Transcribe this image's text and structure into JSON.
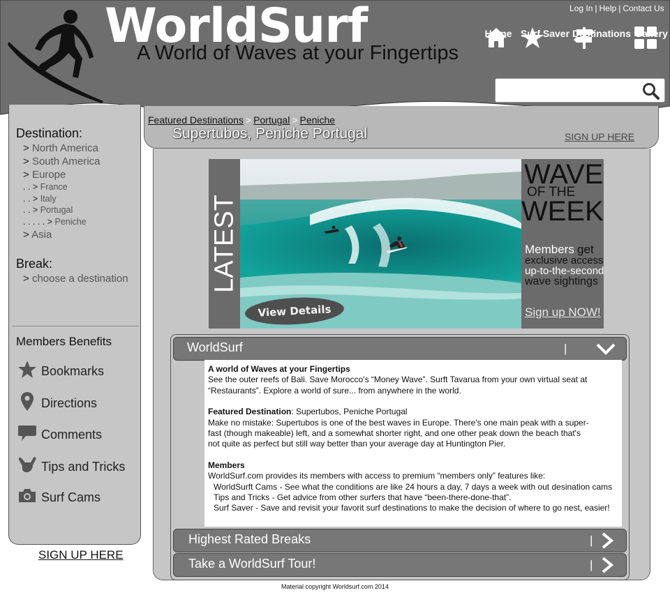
{
  "brand": {
    "title": "WorldSurf",
    "tagline": "A World of Waves at your Fingertips"
  },
  "top_links": [
    "Log In",
    "Help",
    "Contact Us"
  ],
  "nav": [
    {
      "label": "Home",
      "icon": "home-icon"
    },
    {
      "label": "Surf Saver",
      "icon": "star-icon"
    },
    {
      "label": "Destinations",
      "icon": "signpost-icon"
    },
    {
      "label": "Gallery",
      "icon": "grid-icon"
    }
  ],
  "search": {
    "placeholder": "",
    "icon": "search-icon"
  },
  "sidebar": {
    "destination_heading": "Destination:",
    "destinations": [
      {
        "prefix": ">",
        "label": "North America"
      },
      {
        "prefix": ">",
        "label": "South America"
      },
      {
        "prefix": ">",
        "label": "Europe"
      },
      {
        "prefix": ". . >",
        "label": "France"
      },
      {
        "prefix": ". . >",
        "label": "Italy"
      },
      {
        "prefix": ". . >",
        "label": "Portugal"
      },
      {
        "prefix": ". . . . . >",
        "label": "Peniche"
      },
      {
        "prefix": ">",
        "label": "Asia"
      }
    ],
    "break_heading": "Break:",
    "break_item": {
      "prefix": ">",
      "label": "choose a destination"
    },
    "benefits_heading": "Members Benefits",
    "benefits": [
      {
        "label": "Bookmarks",
        "icon": "star-icon"
      },
      {
        "label": "Directions",
        "icon": "map-pin-icon"
      },
      {
        "label": "Comments",
        "icon": "comment-icon"
      },
      {
        "label": "Tips and Tricks",
        "icon": "shaka-hand-icon"
      },
      {
        "label": "Surf Cams",
        "icon": "camera-icon"
      }
    ],
    "signup": "SIGN UP HERE"
  },
  "breadcrumb": [
    "Featured Destinations",
    "Portugal",
    "Peniche"
  ],
  "breadcrumb_sep": ">",
  "page_title": "Supertubos, Peniche Portugal",
  "title_signup": "SIGN UP HERE",
  "hero": {
    "latest": "LATEST",
    "view_details": "View Details",
    "wotw": {
      "wave": "WAVE",
      "of_the": "OF THE",
      "week": "WEEK"
    },
    "members": "Members",
    "get": "get",
    "line2": "exclusive access",
    "line3": "up-to-the-second",
    "line4": "wave sightings",
    "signup": "Sign up NOW!"
  },
  "accordions": [
    {
      "label": "WorldSurf",
      "expanded": true
    },
    {
      "label": "Highest Rated Breaks",
      "expanded": false
    },
    {
      "label": "Take a WorldSurf Tour!",
      "expanded": false
    }
  ],
  "content": {
    "h1": "A world of Waves at your Fingertips",
    "p1a": "See the outer reefs of Bali. Save Morocco’s “Money Wave”. Surft Tavarua from your own virtual seat at",
    "p1b": "“Restaurants”. Explore a world of sure... from anywhere in the world.",
    "h2": "Featured Destination",
    "h2rest": ": Supertubos, Peniche Portugal",
    "p2a": "Make no mistake: Supertubos is one of the best waves in Europe. There's one main peak with a super-",
    "p2b": "fast (though makeable) left, and a somewhat shorter right, and one other peak down the beach that's",
    "p2c": "not quite as perfect but still way better than your average day at Huntington Pier.",
    "h3": "Members",
    "p3": "WorldSurf.com provides its members with access to premium “members only” features like:",
    "f1": "WorldSurft Cams - See what the conditions are like 24 hours a day, 7 days a week with out desination cams",
    "f2": "Tips and Tricks - Get advice from other surfers that have “been-there-done-that”.",
    "f3": "Surf Saver - Save and revisit your favorit surf destinations to make the decision of where to go nest, easier!"
  },
  "copyright": "Material copyright Worldsurf.com 2014",
  "colors": {
    "header": "#6e6e6e",
    "panel": "#c6c6c6",
    "accordion": "#777777",
    "wave": "#1aa39a"
  }
}
